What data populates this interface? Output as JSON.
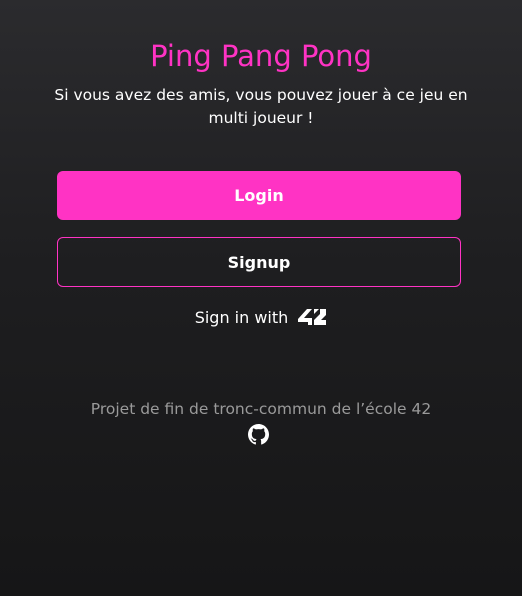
{
  "header": {
    "title": "Ping Pang Pong",
    "subtitle": "Si vous avez des amis, vous pouvez jouer à ce jeu en multi joueur !"
  },
  "actions": {
    "login_label": "Login",
    "signup_label": "Signup",
    "signin_42_label": "Sign in with",
    "signin_42_icon": "42-logo-icon"
  },
  "footer": {
    "text": "Projet de fin de tronc-commun de l’école 42",
    "icon": "github-icon"
  },
  "colors": {
    "accent": "#ff33c4",
    "background": "#1e1e20",
    "muted_text": "#9a9a9a"
  }
}
